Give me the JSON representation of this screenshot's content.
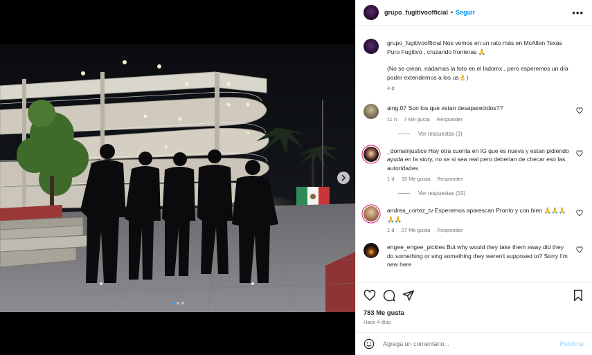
{
  "post": {
    "username": "grupo_fugitivoofficial",
    "separator": "•",
    "follow_label": "Seguir",
    "more_label": "•••"
  },
  "caption": {
    "username": "grupo_fugitivoofficial",
    "text_line1": "Nos vemos en un rato más en McAllen Texas Puro Fugitivo , cruzando fronteras 🙏",
    "text_line2": "(No se crean, nadamas la foto en el ladomx , pero esperemos un día poder extendernos a los us👌)",
    "time": "4 d"
  },
  "comments": [
    {
      "username": "aing.07",
      "text": "Son los que estan desaparecidos??",
      "time": "11 h",
      "likes": "7 Me gusta",
      "reply_label": "Responder",
      "avatar_color": "#8a7d66",
      "view_replies": "Ver respuestas (3)"
    },
    {
      "username": "_domainjustice",
      "text": "Hay otra cuenta en IG que es nueva y estan pidiendo ayuda en la story, no se si sea real pero deberian de checar eso las autoridades",
      "time": "1 d",
      "likes": "33 Me gusta",
      "reply_label": "Responder",
      "avatar_color": "#d62976",
      "view_replies": "Ver respuestas (15)"
    },
    {
      "username": "andrea_cortez_tv",
      "text": "Esperemos aparescan Pronto y con bien 🙏🙏🙏🙏🙏",
      "time": "1 d",
      "likes": "27 Me gusta",
      "reply_label": "Responder",
      "avatar_color": "#c9a07a"
    },
    {
      "username": "engee_engee_pickles",
      "text": "But why would they take them away did they do something or sing something they weren't supposed to? Sorry I'm new here",
      "avatar_color": "#1a1a1a"
    }
  ],
  "actions": {
    "likes": "783 Me gusta",
    "posted_ago": "Hace 4 días",
    "icons": [
      "heart-icon",
      "comment-icon",
      "share-icon",
      "bookmark-icon"
    ]
  },
  "add_comment": {
    "placeholder": "Agrega un comentario...",
    "publish_label": "Publicar",
    "icon": "emoji-icon"
  },
  "carousel": {
    "slide_count": 3,
    "active_index": 0,
    "next_icon": "chevron-right-icon"
  },
  "colors": {
    "accent": "#0095f6",
    "publish_disabled": "#b2dffc",
    "muted": "#737373",
    "dot_active": "#3897f0"
  }
}
